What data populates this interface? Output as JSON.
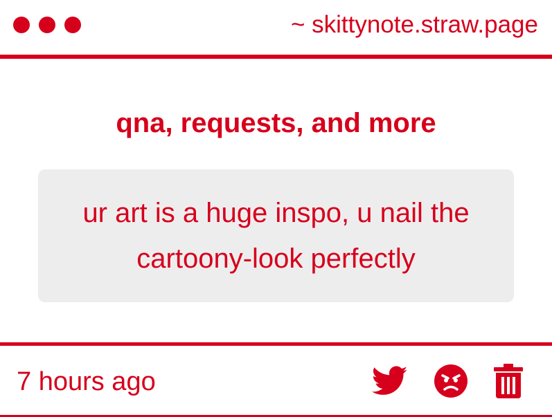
{
  "window": {
    "dots": [
      "red",
      "red",
      "red"
    ],
    "domain": "~ skittynote.straw.page"
  },
  "main": {
    "heading": "qna, requests, and more",
    "message": "ur art is a huge inspo, u nail the cartoony-look perfectly"
  },
  "footer": {
    "timestamp": "7 hours ago",
    "actions": [
      {
        "icon": "twitter-icon"
      },
      {
        "icon": "angry-face-icon"
      },
      {
        "icon": "trash-icon"
      }
    ]
  },
  "colors": {
    "accent": "#d6001c",
    "box_bg": "#eeedee",
    "background": "#ffffff"
  }
}
